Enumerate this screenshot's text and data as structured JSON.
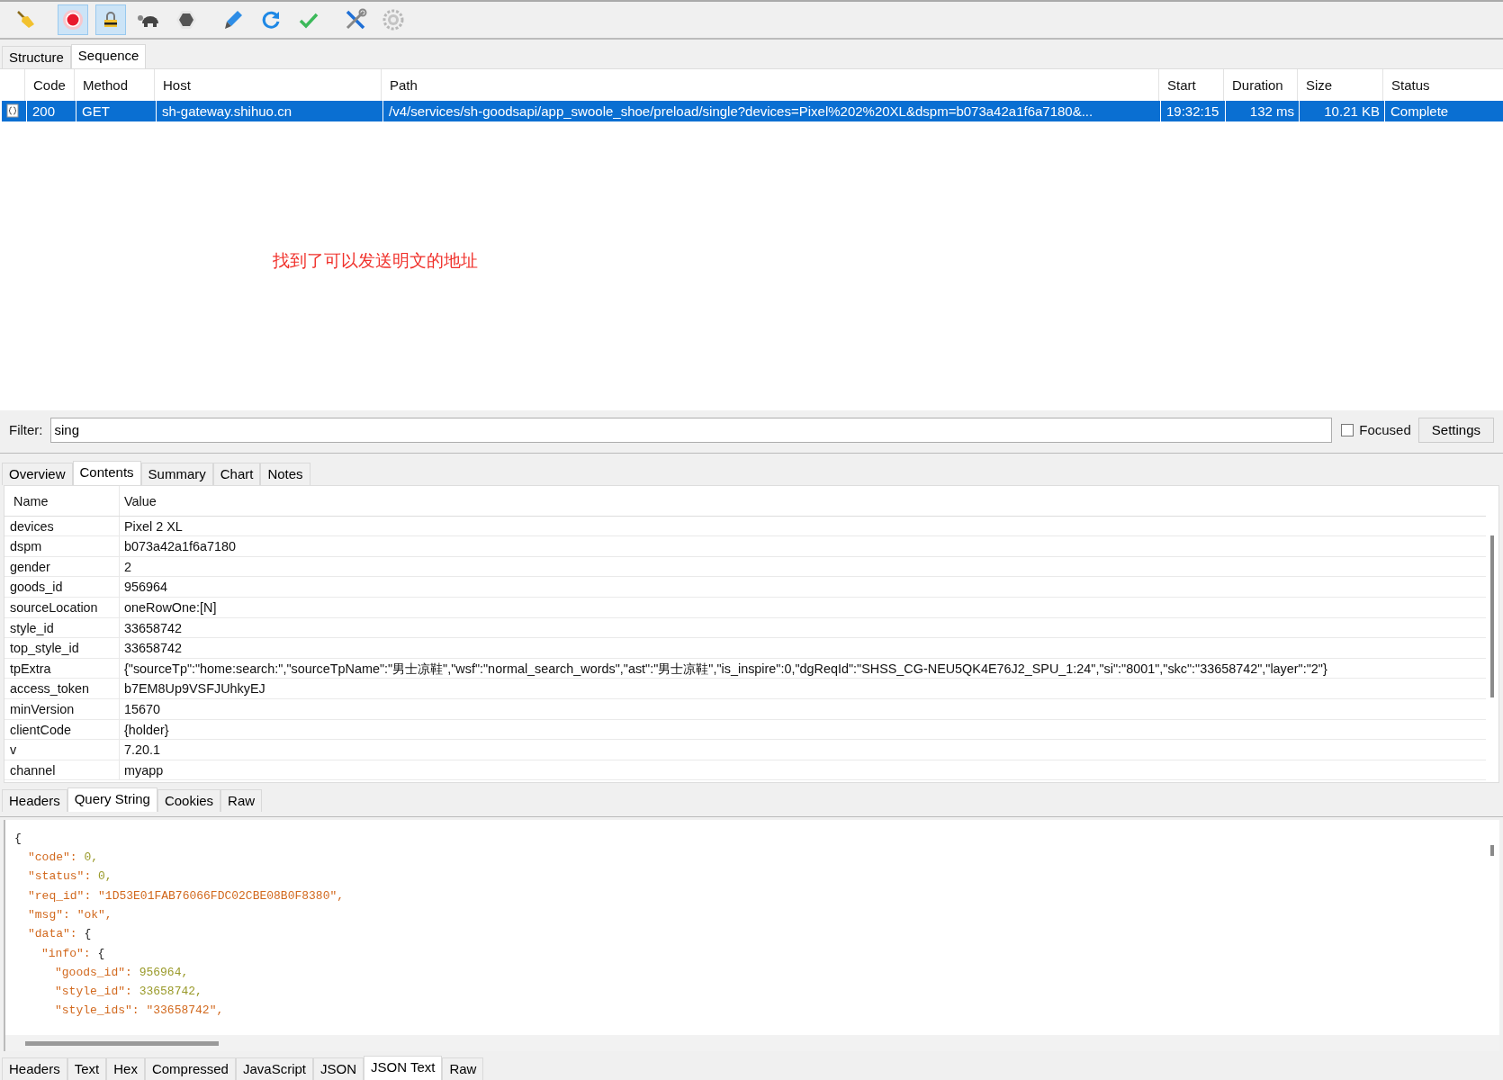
{
  "toolbar": [
    {
      "kind": "broom",
      "selected": false
    },
    {
      "kind": "record",
      "selected": true
    },
    {
      "kind": "lock",
      "selected": true
    },
    {
      "kind": "turtle",
      "selected": false
    },
    {
      "kind": "stop",
      "selected": false
    },
    {
      "kind": "pen",
      "selected": false
    },
    {
      "kind": "refresh",
      "selected": false
    },
    {
      "kind": "check",
      "selected": false
    },
    {
      "kind": "tools",
      "selected": false
    },
    {
      "kind": "gear",
      "selected": false
    }
  ],
  "view_tabs": [
    {
      "label": "Structure",
      "selected": false
    },
    {
      "label": "Sequence",
      "selected": true
    }
  ],
  "requests": {
    "columns": [
      "Code",
      "Method",
      "Host",
      "Path",
      "Start",
      "Duration",
      "Size",
      "Status"
    ],
    "rows": [
      {
        "selected": true,
        "cells": [
          "200",
          "GET",
          "sh-gateway.shihuo.cn",
          "/v4/services/sh-goodsapi/app_swoole_shoe/preload/single?devices=Pixel%202%20XL&dspm=b073a42a1f6a7180&...",
          "19:32:15",
          "132 ms",
          "10.21 KB",
          "Complete"
        ]
      }
    ]
  },
  "annotation": "找到了可以发送明文的地址",
  "filter": {
    "label": "Filter:",
    "value": "sing",
    "focused_label": "Focused",
    "focused_checked": false,
    "settings_button": "Settings"
  },
  "detail_tabs": [
    {
      "label": "Overview",
      "selected": false
    },
    {
      "label": "Contents",
      "selected": true
    },
    {
      "label": "Summary",
      "selected": false
    },
    {
      "label": "Chart",
      "selected": false
    },
    {
      "label": "Notes",
      "selected": false
    }
  ],
  "query_table": {
    "columns": [
      "Name",
      "Value"
    ],
    "rows": [
      {
        "name": "devices",
        "value": "Pixel 2 XL"
      },
      {
        "name": "dspm",
        "value": "b073a42a1f6a7180"
      },
      {
        "name": "gender",
        "value": "2"
      },
      {
        "name": "goods_id",
        "value": "956964"
      },
      {
        "name": "sourceLocation",
        "value": "oneRowOne:[N]"
      },
      {
        "name": "style_id",
        "value": "33658742"
      },
      {
        "name": "top_style_id",
        "value": "33658742"
      },
      {
        "name": "tpExtra",
        "value": "{\"sourceTp\":\"home:search:\",\"sourceTpName\":\"男士凉鞋\",\"wsf\":\"normal_search_words\",\"ast\":\"男士凉鞋\",\"is_inspire\":0,\"dgReqId\":\"SHSS_CG-NEU5QK4E76J2_SPU_1:24\",\"si\":\"8001\",\"skc\":\"33658742\",\"layer\":\"2\"}"
      },
      {
        "name": "access_token",
        "value": "b7EM8Up9VSFJUhkyEJ"
      },
      {
        "name": "minVersion",
        "value": "15670"
      },
      {
        "name": "clientCode",
        "value": "{holder}"
      },
      {
        "name": "v",
        "value": "7.20.1"
      },
      {
        "name": "channel",
        "value": "myapp"
      }
    ]
  },
  "request_tabs": [
    {
      "label": "Headers",
      "selected": false
    },
    {
      "label": "Query String",
      "selected": true
    },
    {
      "label": "Cookies",
      "selected": false
    },
    {
      "label": "Raw",
      "selected": false
    }
  ],
  "response_body": {
    "open": "{",
    "entries": [
      {
        "key": "\"code\":",
        "value": "0,",
        "kind": "number"
      },
      {
        "key": "\"status\":",
        "value": "0,",
        "kind": "number"
      },
      {
        "key": "\"req_id\":",
        "value": "\"1D53E01FAB76066FDC02CBE08B0F8380\",",
        "kind": "string"
      },
      {
        "key": "\"msg\":",
        "value": "\"ok\",",
        "kind": "string"
      },
      {
        "key": "\"data\":",
        "value": "{",
        "kind": "brace",
        "children": [
          {
            "key": "\"info\":",
            "value": "{",
            "kind": "brace",
            "children": [
              {
                "key": "\"goods_id\":",
                "value": "956964,",
                "kind": "number"
              },
              {
                "key": "\"style_id\":",
                "value": "33658742,",
                "kind": "number"
              },
              {
                "key": "\"style_ids\":",
                "value": "\"33658742\",",
                "kind": "string"
              }
            ]
          }
        ]
      }
    ]
  },
  "response_tabs": [
    {
      "label": "Headers",
      "selected": false
    },
    {
      "label": "Text",
      "selected": false
    },
    {
      "label": "Hex",
      "selected": false
    },
    {
      "label": "Compressed",
      "selected": false
    },
    {
      "label": "JavaScript",
      "selected": false
    },
    {
      "label": "JSON",
      "selected": false
    },
    {
      "label": "JSON Text",
      "selected": true
    },
    {
      "label": "Raw",
      "selected": false
    }
  ]
}
